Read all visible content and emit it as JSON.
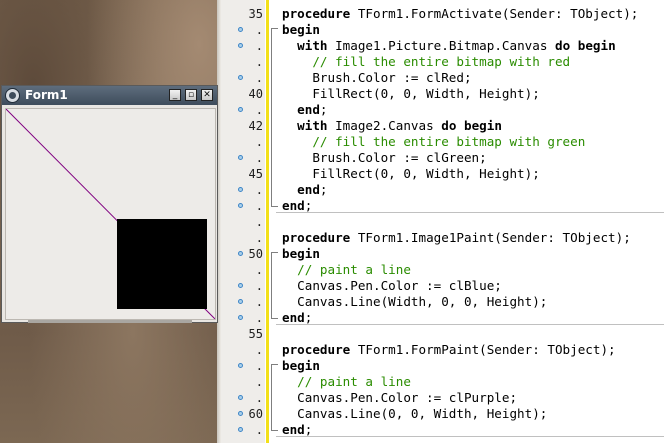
{
  "form": {
    "title": "Form1",
    "buttons": {
      "minimize": "_",
      "restore": "▫",
      "close": "✕"
    },
    "canvas": {
      "background": "#edebe8",
      "square_color": "#000000",
      "purple_line": "#800080",
      "blue_line": "#2020c0"
    }
  },
  "editor": {
    "lines": [
      {
        "number": "35",
        "bp": false,
        "fold": "",
        "segments": [
          {
            "t": "procedure",
            "c": "kw"
          },
          {
            "t": " TForm1.FormActivate(Sender: TObject);",
            "c": ""
          }
        ]
      },
      {
        "number": ".",
        "bp": true,
        "fold": "open",
        "segments": [
          {
            "t": "begin",
            "c": "kw"
          }
        ]
      },
      {
        "number": ".",
        "bp": true,
        "fold": "mid",
        "segments": [
          {
            "t": "  ",
            "c": ""
          },
          {
            "t": "with",
            "c": "kw"
          },
          {
            "t": " Image1.Picture.Bitmap.Canvas ",
            "c": ""
          },
          {
            "t": "do",
            "c": "kw"
          },
          {
            "t": " ",
            "c": ""
          },
          {
            "t": "begin",
            "c": "kw"
          }
        ]
      },
      {
        "number": ".",
        "bp": false,
        "fold": "mid",
        "segments": [
          {
            "t": "    // fill the entire bitmap with red",
            "c": "cm"
          }
        ]
      },
      {
        "number": ".",
        "bp": true,
        "fold": "mid",
        "segments": [
          {
            "t": "    Brush.Color := clRed;",
            "c": ""
          }
        ]
      },
      {
        "number": "40",
        "bp": false,
        "fold": "mid",
        "segments": [
          {
            "t": "    FillRect(0, 0, Width, Height);",
            "c": ""
          }
        ]
      },
      {
        "number": ".",
        "bp": true,
        "fold": "mid",
        "segments": [
          {
            "t": "  ",
            "c": ""
          },
          {
            "t": "end",
            "c": "kw"
          },
          {
            "t": ";",
            "c": ""
          }
        ]
      },
      {
        "number": "42",
        "bp": false,
        "fold": "mid",
        "segments": [
          {
            "t": "  ",
            "c": ""
          },
          {
            "t": "with",
            "c": "kw"
          },
          {
            "t": " Image2.Canvas ",
            "c": ""
          },
          {
            "t": "do",
            "c": "kw"
          },
          {
            "t": " ",
            "c": ""
          },
          {
            "t": "begin",
            "c": "kw"
          }
        ]
      },
      {
        "number": ".",
        "bp": false,
        "fold": "mid",
        "segments": [
          {
            "t": "    // fill the entire bitmap with green",
            "c": "cm"
          }
        ]
      },
      {
        "number": ".",
        "bp": true,
        "fold": "mid",
        "segments": [
          {
            "t": "    Brush.Color := clGreen;",
            "c": ""
          }
        ]
      },
      {
        "number": "45",
        "bp": false,
        "fold": "mid",
        "segments": [
          {
            "t": "    FillRect(0, 0, Width, Height);",
            "c": ""
          }
        ]
      },
      {
        "number": ".",
        "bp": true,
        "fold": "mid",
        "segments": [
          {
            "t": "  ",
            "c": ""
          },
          {
            "t": "end",
            "c": "kw"
          },
          {
            "t": ";",
            "c": ""
          }
        ]
      },
      {
        "number": ".",
        "bp": true,
        "fold": "end",
        "segments": [
          {
            "t": "end",
            "c": "kw"
          },
          {
            "t": ";",
            "c": ""
          }
        ]
      },
      {
        "number": ".",
        "bp": false,
        "fold": "",
        "segments": []
      },
      {
        "number": ".",
        "bp": false,
        "fold": "",
        "segments": [
          {
            "t": "procedure",
            "c": "kw"
          },
          {
            "t": " TForm1.Image1Paint(Sender: TObject);",
            "c": ""
          }
        ]
      },
      {
        "number": "50",
        "bp": true,
        "fold": "open",
        "segments": [
          {
            "t": "begin",
            "c": "kw"
          }
        ]
      },
      {
        "number": ".",
        "bp": false,
        "fold": "mid",
        "segments": [
          {
            "t": "  // paint a line",
            "c": "cm"
          }
        ]
      },
      {
        "number": ".",
        "bp": true,
        "fold": "mid",
        "segments": [
          {
            "t": "  Canvas.Pen.Color := clBlue;",
            "c": ""
          }
        ]
      },
      {
        "number": ".",
        "bp": true,
        "fold": "mid",
        "segments": [
          {
            "t": "  Canvas.Line(Width, 0, 0, Height);",
            "c": ""
          }
        ]
      },
      {
        "number": ".",
        "bp": true,
        "fold": "end",
        "segments": [
          {
            "t": "end",
            "c": "kw"
          },
          {
            "t": ";",
            "c": ""
          }
        ]
      },
      {
        "number": "55",
        "bp": false,
        "fold": "",
        "segments": []
      },
      {
        "number": ".",
        "bp": false,
        "fold": "",
        "segments": [
          {
            "t": "procedure",
            "c": "kw"
          },
          {
            "t": " TForm1.FormPaint(Sender: TObject);",
            "c": ""
          }
        ]
      },
      {
        "number": ".",
        "bp": true,
        "fold": "open",
        "segments": [
          {
            "t": "begin",
            "c": "kw"
          }
        ]
      },
      {
        "number": ".",
        "bp": false,
        "fold": "mid",
        "segments": [
          {
            "t": "  // paint a line",
            "c": "cm"
          }
        ]
      },
      {
        "number": ".",
        "bp": true,
        "fold": "mid",
        "segments": [
          {
            "t": "  Canvas.Pen.Color := clPurple;",
            "c": ""
          }
        ]
      },
      {
        "number": "60",
        "bp": true,
        "fold": "mid",
        "segments": [
          {
            "t": "  Canvas.Line(0, 0, Width, Height);",
            "c": ""
          }
        ]
      },
      {
        "number": ".",
        "bp": true,
        "fold": "end",
        "segments": [
          {
            "t": "end",
            "c": "kw"
          },
          {
            "t": ";",
            "c": ""
          }
        ]
      }
    ],
    "colors": {
      "comment": "#2a8c00",
      "change_bar": "#f3e019",
      "breakpoint": "#3f86c6"
    }
  }
}
